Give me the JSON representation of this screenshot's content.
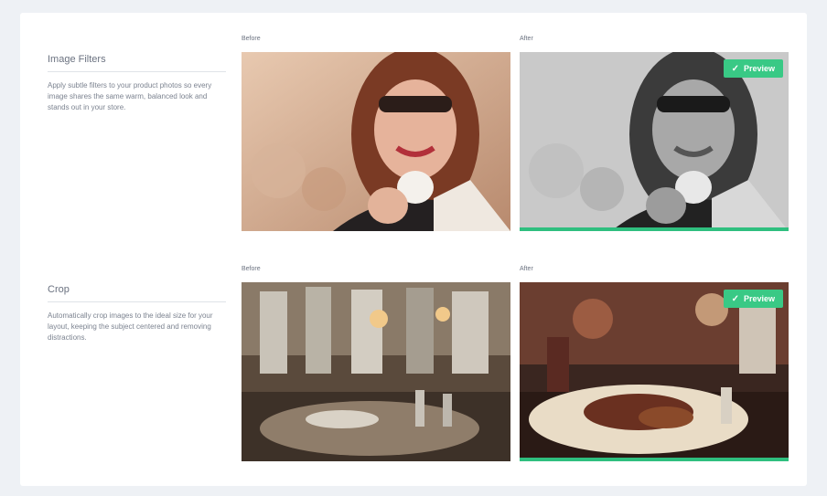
{
  "sections": [
    {
      "title": "Image Filters",
      "description": "Apply subtle filters to your product photos so every image shares the same warm, balanced look and stands out in your store."
    },
    {
      "title": "Crop",
      "description": "Automatically crop images to the ideal size for your layout, keeping the subject centered and removing distractions."
    }
  ],
  "rows": [
    {
      "before_label": "Before",
      "after_label": "After",
      "badge_label": "Preview"
    },
    {
      "before_label": "Before",
      "after_label": "After",
      "badge_label": "Preview"
    }
  ],
  "colors": {
    "accent": "#2fbf7f",
    "badge": "#39c985"
  },
  "icons": {
    "badge_icon": "checkmark-icon"
  }
}
